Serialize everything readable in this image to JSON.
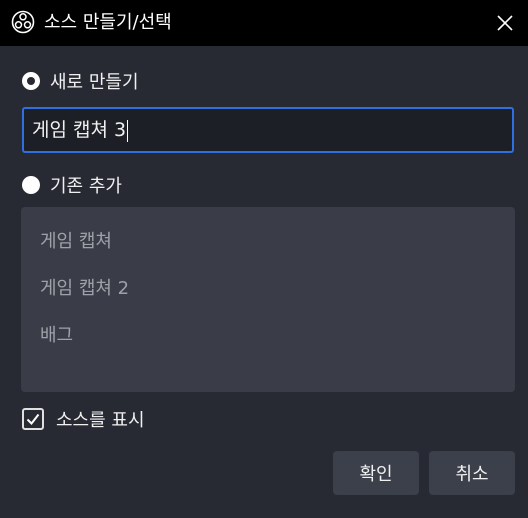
{
  "window": {
    "title": "소스 만들기/선택"
  },
  "create_new": {
    "label": "새로 만들기",
    "selected": true,
    "name_value": "게임 캡쳐 3"
  },
  "add_existing": {
    "label": "기존 추가",
    "selected": false,
    "items": [
      "게임 캡쳐",
      "게임 캡쳐 2",
      "배그"
    ]
  },
  "show_source": {
    "label": "소스를 표시",
    "checked": true
  },
  "buttons": {
    "ok": "확인",
    "cancel": "취소"
  },
  "colors": {
    "accent": "#2f6fe0",
    "background": "#272a33",
    "titlebar": "#000000"
  }
}
